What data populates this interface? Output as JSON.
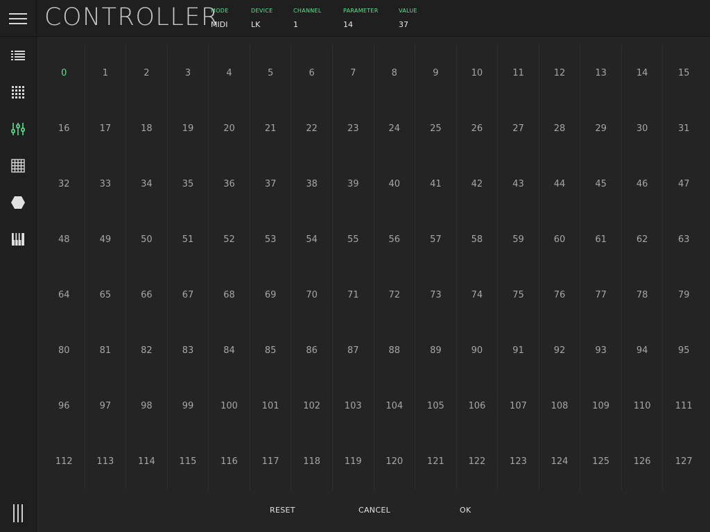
{
  "app": {
    "title": "CONTROLLER"
  },
  "info": {
    "mode": {
      "label": "MODE",
      "value": "MIDI"
    },
    "device": {
      "label": "DEVICE",
      "value": "LK"
    },
    "channel": {
      "label": "CHANNEL",
      "value": "1"
    },
    "parameter": {
      "label": "PARAMETER",
      "value": "14"
    },
    "value": {
      "label": "VALUE",
      "value": "37"
    }
  },
  "sidebar": {
    "items": [
      {
        "icon": "list-icon",
        "active": false
      },
      {
        "icon": "dot-grid-icon",
        "active": false
      },
      {
        "icon": "mixer-sliders-icon",
        "active": true
      },
      {
        "icon": "grid-icon",
        "active": false
      },
      {
        "icon": "hexagon-icon",
        "active": false
      },
      {
        "icon": "piano-keys-icon",
        "active": false
      }
    ]
  },
  "grid": {
    "selected": 0,
    "values": [
      "0",
      "1",
      "2",
      "3",
      "4",
      "5",
      "6",
      "7",
      "8",
      "9",
      "10",
      "11",
      "12",
      "13",
      "14",
      "15",
      "16",
      "17",
      "18",
      "19",
      "20",
      "21",
      "22",
      "23",
      "24",
      "25",
      "26",
      "27",
      "28",
      "29",
      "30",
      "31",
      "32",
      "33",
      "34",
      "35",
      "36",
      "37",
      "38",
      "39",
      "40",
      "41",
      "42",
      "43",
      "44",
      "45",
      "46",
      "47",
      "48",
      "49",
      "50",
      "51",
      "52",
      "53",
      "54",
      "55",
      "56",
      "57",
      "58",
      "59",
      "60",
      "61",
      "62",
      "63",
      "64",
      "65",
      "66",
      "67",
      "68",
      "69",
      "70",
      "71",
      "72",
      "73",
      "74",
      "75",
      "76",
      "77",
      "78",
      "79",
      "80",
      "81",
      "82",
      "83",
      "84",
      "85",
      "86",
      "87",
      "88",
      "89",
      "90",
      "91",
      "92",
      "93",
      "94",
      "95",
      "96",
      "97",
      "98",
      "99",
      "100",
      "101",
      "102",
      "103",
      "104",
      "105",
      "106",
      "107",
      "108",
      "109",
      "110",
      "111",
      "112",
      "113",
      "114",
      "115",
      "116",
      "117",
      "118",
      "119",
      "120",
      "121",
      "122",
      "123",
      "124",
      "125",
      "126",
      "127"
    ]
  },
  "footer": {
    "reset": "RESET",
    "cancel": "CANCEL",
    "ok": "OK"
  },
  "colors": {
    "accent": "#5fe090",
    "background": "#242424",
    "panel": "#1f1f1f",
    "text": "#a6a6a6"
  }
}
